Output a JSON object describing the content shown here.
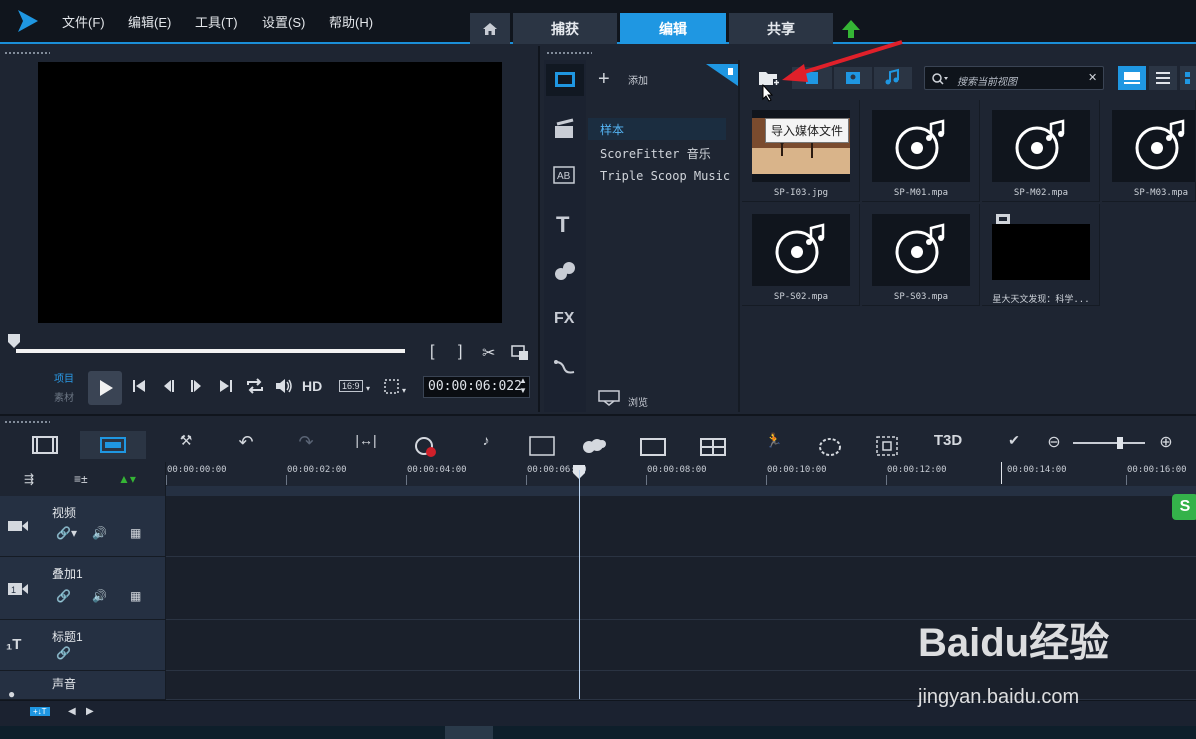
{
  "menubar": {
    "items": [
      "文件(F)",
      "编辑(E)",
      "工具(T)",
      "设置(S)",
      "帮助(H)"
    ],
    "tabs": [
      {
        "label": "",
        "icon": "home-icon"
      },
      {
        "label": "捕获"
      },
      {
        "label": "编辑",
        "active": true
      },
      {
        "label": "共享"
      }
    ]
  },
  "player": {
    "mode_project": "项目",
    "mode_clip": "素材",
    "hd": "HD",
    "ratio": "16:9",
    "timecode": "00:00:06:022"
  },
  "library": {
    "add_label": "添加",
    "browse_label": "浏览",
    "tree": [
      "样本",
      "ScoreFitter 音乐",
      "Triple Scoop Music"
    ],
    "search_placeholder": "搜索当前视图",
    "tooltip": "导入媒体文件",
    "items": [
      {
        "label": "SP-I03.jpg",
        "kind": "image"
      },
      {
        "label": "SP-M01.mpa",
        "kind": "audio"
      },
      {
        "label": "SP-M02.mpa",
        "kind": "audio"
      },
      {
        "label": "SP-M03.mpa",
        "kind": "audio"
      },
      {
        "label": "SP-S02.mpa",
        "kind": "audio"
      },
      {
        "label": "SP-S03.mpa",
        "kind": "audio"
      },
      {
        "label": "星大天文发现：科学...",
        "kind": "video"
      }
    ]
  },
  "timeline": {
    "ticks": [
      "00:00:00:00",
      "00:00:02:00",
      "00:00:04:00",
      "00:00:06:00",
      "00:00:08:00",
      "00:00:10:00",
      "00:00:12:00",
      "00:00:14:00",
      "00:00:16:00"
    ],
    "tracks": [
      "视频",
      "叠加1",
      "标题1",
      "声音"
    ]
  },
  "watermark": {
    "brand": "Baidu经验",
    "url": "jingyan.baidu.com"
  },
  "colors": {
    "accent": "#1f97e2",
    "arrow": "#e0202a",
    "upload": "#35b535"
  }
}
